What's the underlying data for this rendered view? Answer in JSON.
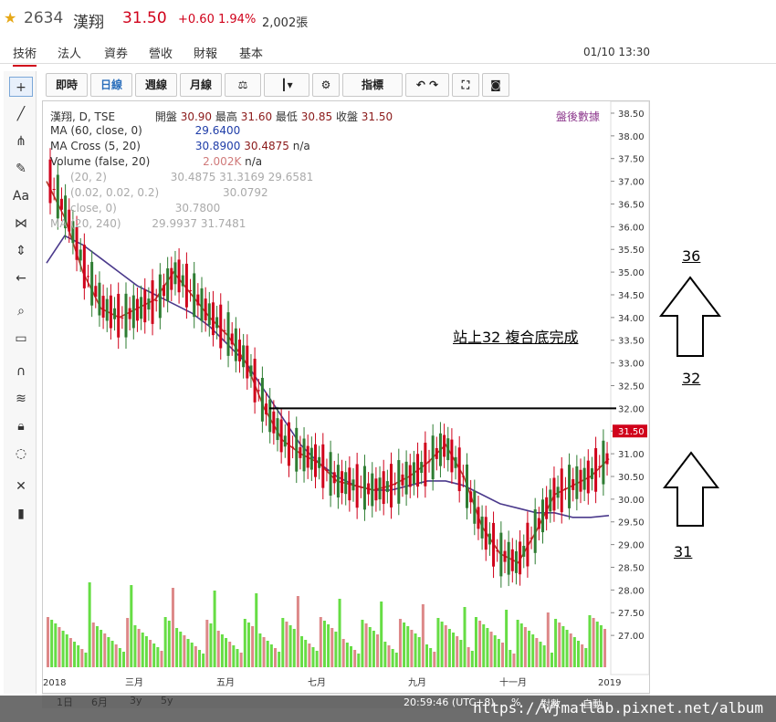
{
  "header": {
    "code": "2634",
    "name": "漢翔",
    "price": "31.50",
    "change": "+0.60",
    "percent": "1.94%",
    "volume": "2,002張"
  },
  "tabs": [
    "技術",
    "法人",
    "資券",
    "營收",
    "財報",
    "基本"
  ],
  "datetime": "01/10 13:30",
  "toolbar": {
    "buttons": [
      "即時",
      "日線",
      "週線",
      "月線"
    ],
    "indicator": "指標"
  },
  "legend": {
    "symbol": "漢翔, D, TSE",
    "open_label": "開盤",
    "open": "30.90",
    "high_label": "最高",
    "high": "31.60",
    "low_label": "最低",
    "low": "30.85",
    "close_label": "收盤",
    "close": "31.50",
    "after_hours": "盤後數據",
    "ma60_label": "MA (60, close, 0)",
    "ma60_value": "29.6400",
    "macross_label": "MA Cross (5, 20)",
    "macross_v1": "30.8900",
    "macross_v2": "30.4875",
    "macross_na": "n/a",
    "vol_label": "Volume (false, 20)",
    "vol_value": "2.002K",
    "vol_na": "n/a",
    "row4_label": "(20, 2)",
    "row4_values": "30.4875 31.3169 29.6581",
    "row5_label": "(0.02, 0.02, 0.2)",
    "row5_value": "30.0792",
    "row6_label": "close, 0)",
    "row6_value": "30.7800",
    "row7_label": "MA (20, 240)",
    "row7_values": "29.9937 31.7481"
  },
  "annotation": {
    "text": "站上32  複合底完成",
    "n36": "36",
    "n32": "32",
    "n31": "31"
  },
  "price_axis": [
    "38.50",
    "38.00",
    "37.50",
    "37.00",
    "36.50",
    "36.00",
    "35.50",
    "35.00",
    "34.50",
    "34.00",
    "33.50",
    "33.00",
    "32.50",
    "32.00",
    "31.50",
    "31.00",
    "30.50",
    "30.00",
    "29.50",
    "29.00",
    "28.50",
    "28.00",
    "27.50",
    "27.00"
  ],
  "current_price_tag": "31.50",
  "month_axis": [
    "2018",
    "三月",
    "五月",
    "七月",
    "九月",
    "十一月",
    "2019"
  ],
  "range_buttons": [
    "1日",
    "6月",
    "3y",
    "5y"
  ],
  "bottom_time": "20:59:46 (UTC+8)",
  "bottom_right": [
    "%",
    "對數",
    "自動"
  ],
  "watermark": "https://wjmatlab.pixnet.net/album",
  "colors": {
    "up": "#d0021b",
    "down": "#2e7d32",
    "ma5": "#1f3da8",
    "ma20": "#b23a2a",
    "ma60": "#4b3a8c"
  },
  "chart_data": {
    "type": "line",
    "title": "漢翔, D, TSE",
    "ylim": [
      26.5,
      38.6
    ],
    "x": [
      0,
      20,
      40,
      60,
      80,
      100,
      120,
      140,
      160,
      180,
      200,
      220,
      240,
      260,
      280,
      300,
      320,
      340,
      360,
      380,
      400,
      420,
      440,
      460,
      480,
      500,
      520,
      540,
      560,
      580,
      600,
      620
    ],
    "series": [
      {
        "name": "MA (60, close, 0)",
        "values": [
          35.2,
          35.8,
          35.6,
          35.3,
          35.0,
          34.7,
          34.5,
          34.3,
          34.1,
          33.8,
          33.4,
          33.0,
          32.4,
          31.8,
          31.2,
          30.8,
          30.5,
          30.3,
          30.2,
          30.2,
          30.3,
          30.4,
          30.4,
          30.3,
          30.1,
          29.9,
          29.8,
          29.7,
          29.7,
          29.6,
          29.6,
          29.64
        ]
      },
      {
        "name": "MA Cross (5, 20)",
        "values": [
          37.0,
          36.2,
          35.0,
          34.2,
          34.0,
          34.2,
          34.4,
          35.0,
          34.5,
          34.0,
          33.6,
          33.0,
          32.0,
          31.3,
          31.0,
          30.8,
          30.4,
          30.3,
          30.2,
          30.3,
          30.5,
          30.8,
          31.2,
          30.5,
          29.4,
          28.8,
          28.6,
          29.3,
          30.1,
          30.3,
          30.5,
          30.89
        ]
      }
    ]
  }
}
